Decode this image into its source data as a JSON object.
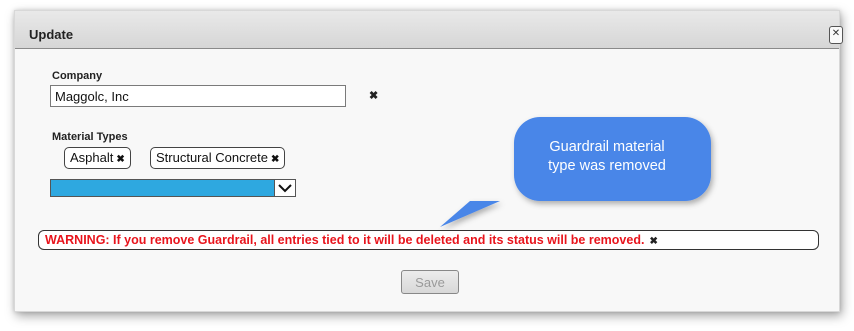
{
  "dialog": {
    "title": "Update",
    "close_glyph": "✕"
  },
  "company": {
    "label": "Company",
    "value": "Maggolc, Inc",
    "clear_glyph": "✖"
  },
  "material_types": {
    "label": "Material Types",
    "chips": [
      {
        "label": "Asphalt",
        "remove_glyph": "✖"
      },
      {
        "label": "Structural Concrete",
        "remove_glyph": "✖"
      }
    ],
    "select_value": ""
  },
  "callout": {
    "line1": "Guardrail material",
    "line2": "type was removed",
    "color": "#4a86e8"
  },
  "warning": {
    "text": "WARNING: If you remove Guardrail, all entries tied to it will be deleted and its status will be removed.",
    "dismiss_glyph": "✖",
    "color": "#e8141c"
  },
  "actions": {
    "save_label": "Save"
  },
  "icons": [
    "close-icon",
    "clear-icon",
    "chevron-down-icon"
  ]
}
